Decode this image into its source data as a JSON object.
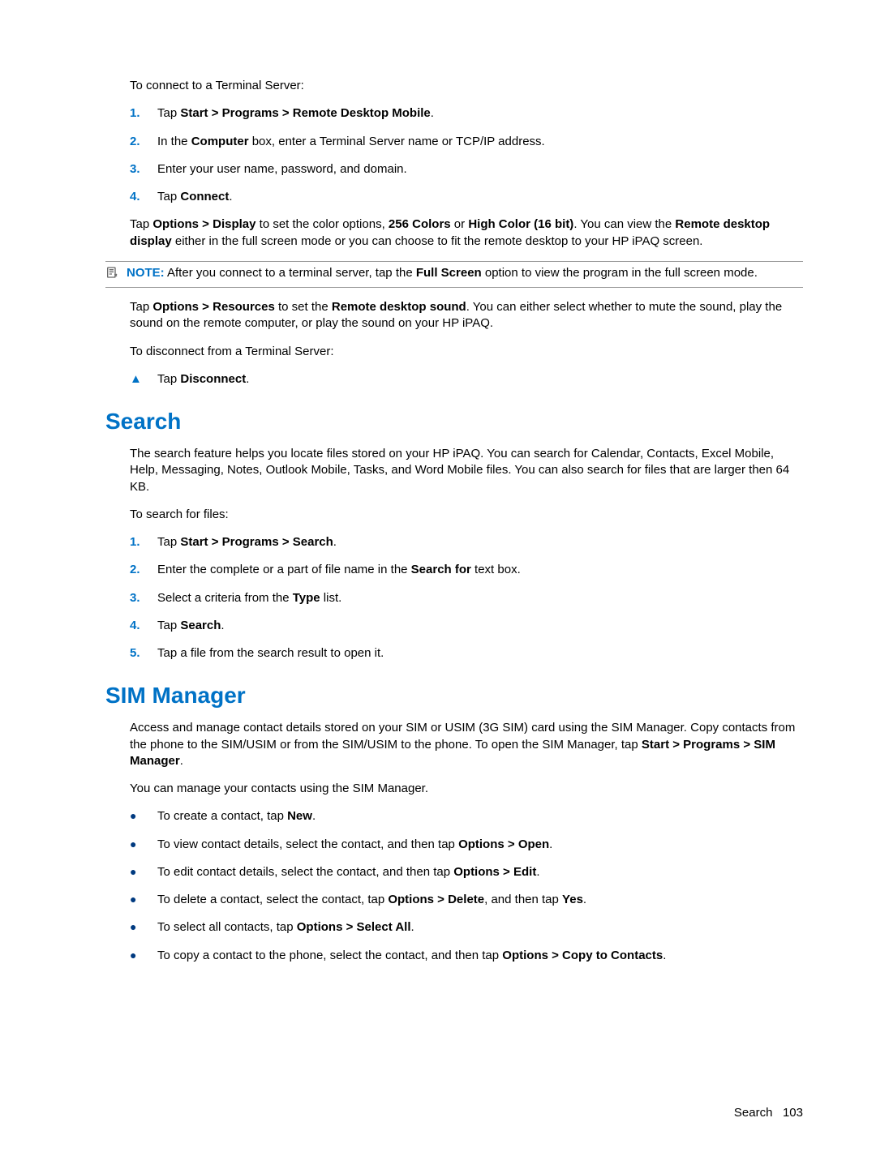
{
  "intro_terminal": "To connect to a Terminal Server:",
  "terminal_steps": {
    "s1_pre": "Tap ",
    "s1_b": "Start > Programs > Remote Desktop Mobile",
    "s1_post": ".",
    "s2_pre": "In the ",
    "s2_b": "Computer",
    "s2_post": " box, enter a Terminal Server name or TCP/IP address.",
    "s3": "Enter your user name, password, and domain.",
    "s4_pre": "Tap ",
    "s4_b": "Connect",
    "s4_post": "."
  },
  "display_para": {
    "pre": "Tap ",
    "b1": "Options > Display",
    "mid1": " to set the color options, ",
    "b2": "256 Colors",
    "mid2": " or ",
    "b3": "High Color (16 bit)",
    "mid3": ". You can view the ",
    "b4": "Remote desktop display",
    "post": " either in the full screen mode or you can choose to fit the remote desktop to your HP iPAQ screen."
  },
  "note": {
    "label": "NOTE:",
    "pre": "   After you connect to a terminal server, tap the ",
    "b": "Full Screen",
    "post": " option to view the program in the full screen mode."
  },
  "resources_para": {
    "pre": "Tap ",
    "b1": "Options > Resources",
    "mid": " to set the ",
    "b2": "Remote desktop sound",
    "post": ". You can either select whether to mute the sound, play the sound on the remote computer, or play the sound on your HP iPAQ."
  },
  "disconnect_intro": "To disconnect from a Terminal Server:",
  "disconnect": {
    "pre": "Tap ",
    "b": "Disconnect",
    "post": "."
  },
  "search_heading": "Search",
  "search_para": "The search feature helps you locate files stored on your HP iPAQ. You can search for Calendar, Contacts, Excel Mobile, Help, Messaging, Notes, Outlook Mobile, Tasks, and Word Mobile files. You can also search for files that are larger then 64 KB.",
  "search_intro": "To search for files:",
  "search_steps": {
    "s1_pre": "Tap ",
    "s1_b": "Start > Programs > Search",
    "s1_post": ".",
    "s2_pre": "Enter the complete or a part of file name in the ",
    "s2_b": "Search for",
    "s2_post": " text box.",
    "s3_pre": "Select a criteria from the ",
    "s3_b": "Type",
    "s3_post": " list.",
    "s4_pre": "Tap ",
    "s4_b": "Search",
    "s4_post": ".",
    "s5": "Tap a file from the search result to open it."
  },
  "sim_heading": "SIM Manager",
  "sim_para": {
    "pre": "Access and manage contact details stored on your SIM or USIM (3G SIM) card using the SIM Manager. Copy contacts from the phone to the SIM/USIM or from the SIM/USIM to the phone. To open the SIM Manager, tap ",
    "b": "Start > Programs > SIM Manager",
    "post": "."
  },
  "sim_intro": "You can manage your contacts using the SIM Manager.",
  "sim_bullets": {
    "b1_pre": "To create a contact, tap ",
    "b1_b": "New",
    "b1_post": ".",
    "b2_pre": "To view contact details, select the contact, and then tap ",
    "b2_b": "Options > Open",
    "b2_post": ".",
    "b3_pre": "To edit contact details, select the contact, and then tap ",
    "b3_b": "Options > Edit",
    "b3_post": ".",
    "b4_pre": "To delete a contact, select the contact, tap ",
    "b4_b": "Options > Delete",
    "b4_mid": ", and then tap ",
    "b4_b2": "Yes",
    "b4_post": ".",
    "b5_pre": "To select all contacts, tap ",
    "b5_b": "Options > Select All",
    "b5_post": ".",
    "b6_pre": "To copy a contact to the phone, select the contact, and then tap ",
    "b6_b": "Options > Copy to Contacts",
    "b6_post": "."
  },
  "footer": {
    "text": "Search",
    "page": "103"
  }
}
